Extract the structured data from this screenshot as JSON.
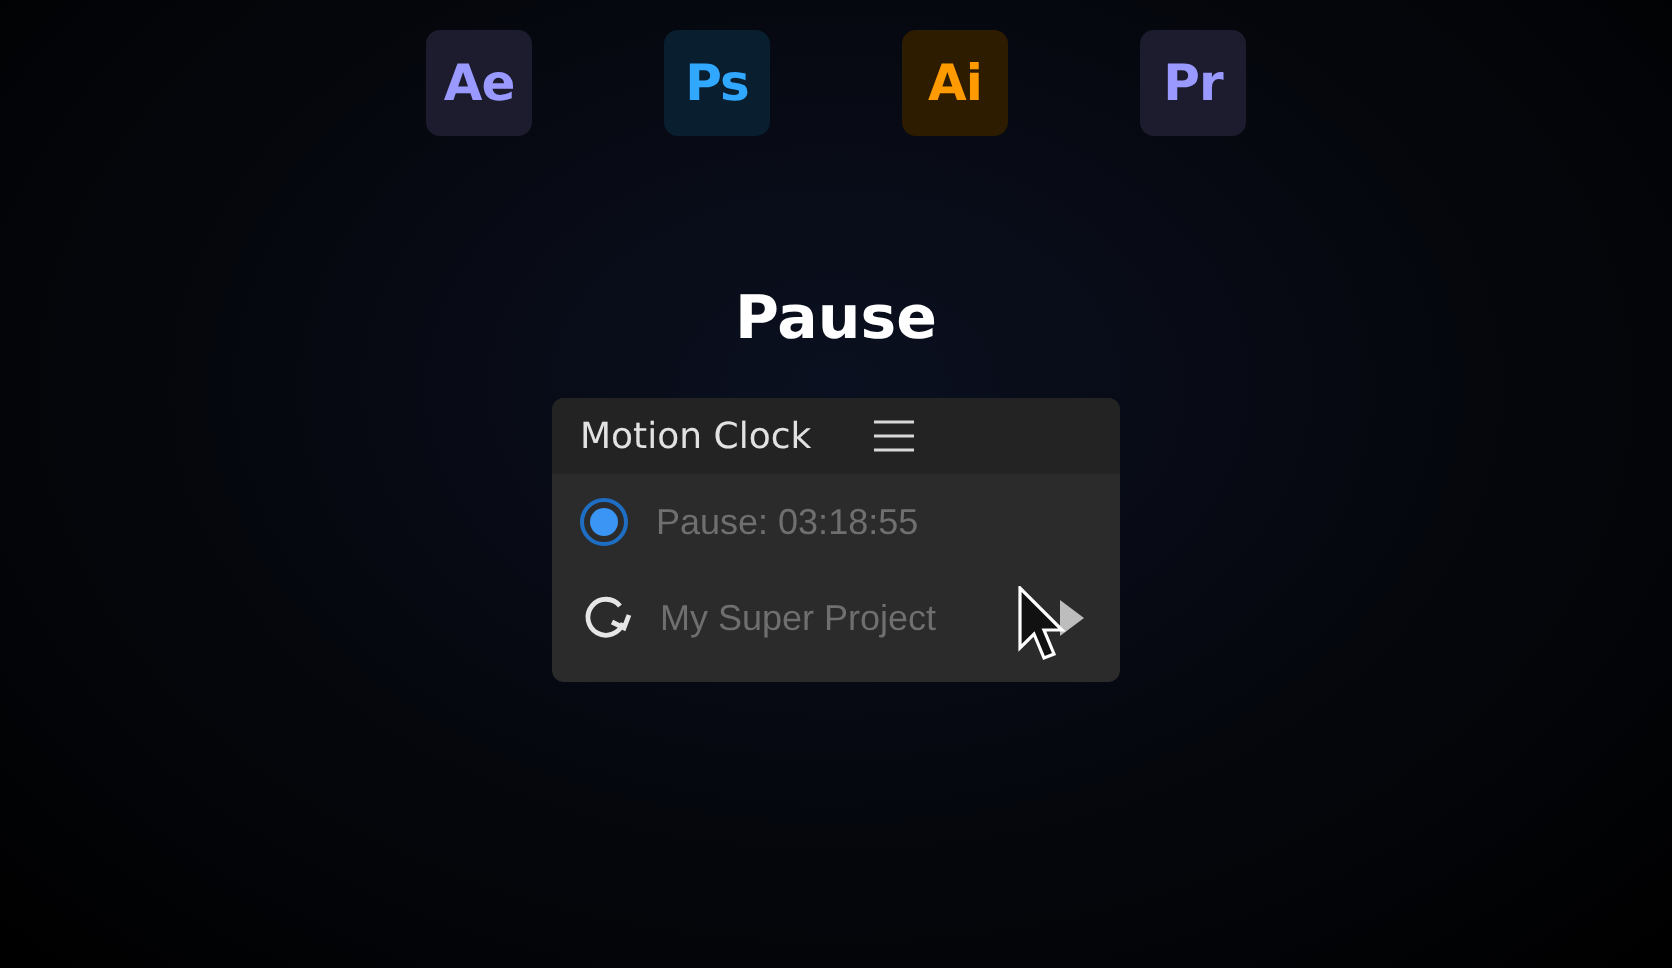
{
  "apps": [
    {
      "label": "Ae",
      "color": "#9999ff"
    },
    {
      "label": "Ps",
      "color": "#31a8ff"
    },
    {
      "label": "Ai",
      "color": "#ff9a00"
    },
    {
      "label": "Pr",
      "color": "#9999ff"
    }
  ],
  "heading": "Pause",
  "panel": {
    "title": "Motion Clock",
    "rows": [
      {
        "kind": "radio",
        "selected": true,
        "text": "Pause: 03:18:55"
      },
      {
        "kind": "refresh",
        "text": "My Super Project"
      }
    ]
  }
}
